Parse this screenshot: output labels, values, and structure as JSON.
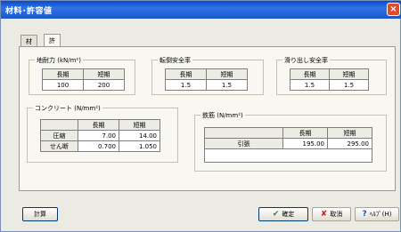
{
  "window": {
    "title": "材料･許容値",
    "close_glyph": "×"
  },
  "tabs": [
    {
      "label": "材料"
    },
    {
      "label": "許容値"
    }
  ],
  "table_headers": {
    "long": "長期",
    "short": "短期"
  },
  "bearing": {
    "label": "地耐力 (kN/m²)",
    "long": "100",
    "short": "200"
  },
  "overturn": {
    "label": "転倒安全率",
    "long": "1.5",
    "short": "1.5"
  },
  "sliding": {
    "label": "滑り出し安全率",
    "long": "1.5",
    "short": "1.5"
  },
  "concrete": {
    "label": "コンクリート (N/mm²)",
    "rows": [
      {
        "name": "圧縮",
        "long": "7.00",
        "short": "14.00"
      },
      {
        "name": "せん断",
        "long": "0.700",
        "short": "1.050"
      }
    ]
  },
  "rebar": {
    "label": "鉄筋 (N/mm²)",
    "rows": [
      {
        "name": "引張",
        "long": "195.00",
        "short": "295.00"
      }
    ]
  },
  "buttons": {
    "calc": "計算",
    "ok": "確定",
    "cancel": "取消",
    "help": "ﾍﾙﾌﾟ(H)"
  },
  "colors": {
    "title_bar": "#1a56cc",
    "ok_icon": "#2a8a2a",
    "cancel_icon": "#cc1f1f",
    "help_icon": "#1a4fcf"
  }
}
